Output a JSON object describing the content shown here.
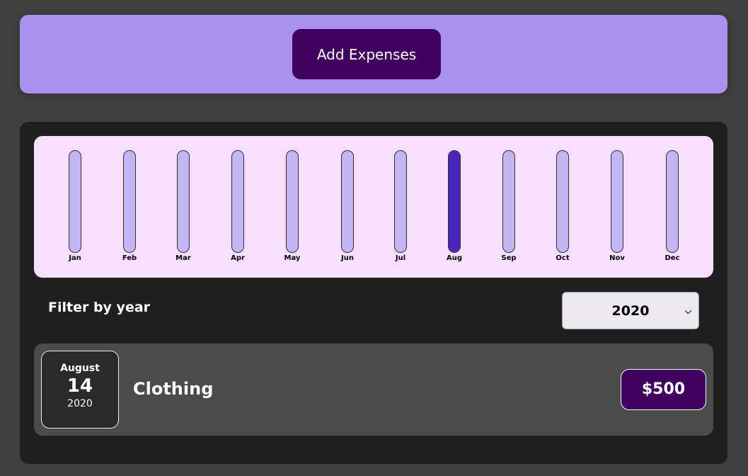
{
  "header": {
    "add_button": "Add Expenses"
  },
  "chart_data": {
    "type": "bar",
    "categories": [
      "Jan",
      "Feb",
      "Mar",
      "Apr",
      "May",
      "Jun",
      "Jul",
      "Aug",
      "Sep",
      "Oct",
      "Nov",
      "Dec"
    ],
    "values": [
      0,
      0,
      0,
      0,
      0,
      0,
      0,
      500,
      0,
      0,
      0,
      0
    ],
    "ylim": [
      0,
      500
    ],
    "colors": {
      "empty": "#c3b4f3",
      "fill": "#4826b9"
    }
  },
  "filter": {
    "label": "Filter by year",
    "selected": "2020"
  },
  "expenses": [
    {
      "month": "August",
      "day": "14",
      "year": "2020",
      "title": "Clothing",
      "amount": "$500"
    }
  ]
}
